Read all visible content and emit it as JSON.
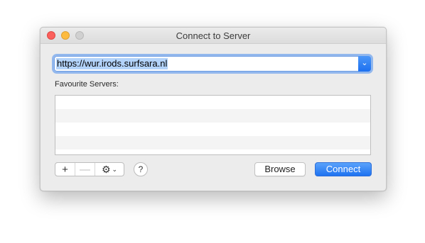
{
  "window": {
    "title": "Connect to Server"
  },
  "url_field": {
    "value": "https://wur.irods.surfsara.nl",
    "dropdown_icon": "chevron-down-icon"
  },
  "favourites": {
    "label": "Favourite Servers:",
    "items": []
  },
  "toolbar": {
    "add_label": "+",
    "remove_label": "—",
    "gear_icon": "⚙",
    "gear_chevron": "⌄",
    "help_label": "?"
  },
  "buttons": {
    "browse_label": "Browse",
    "connect_label": "Connect"
  },
  "colors": {
    "accent": "#1e72f0",
    "close": "#fc605c",
    "minimize": "#fdbc40",
    "zoom_disabled": "#d0d0d0"
  }
}
